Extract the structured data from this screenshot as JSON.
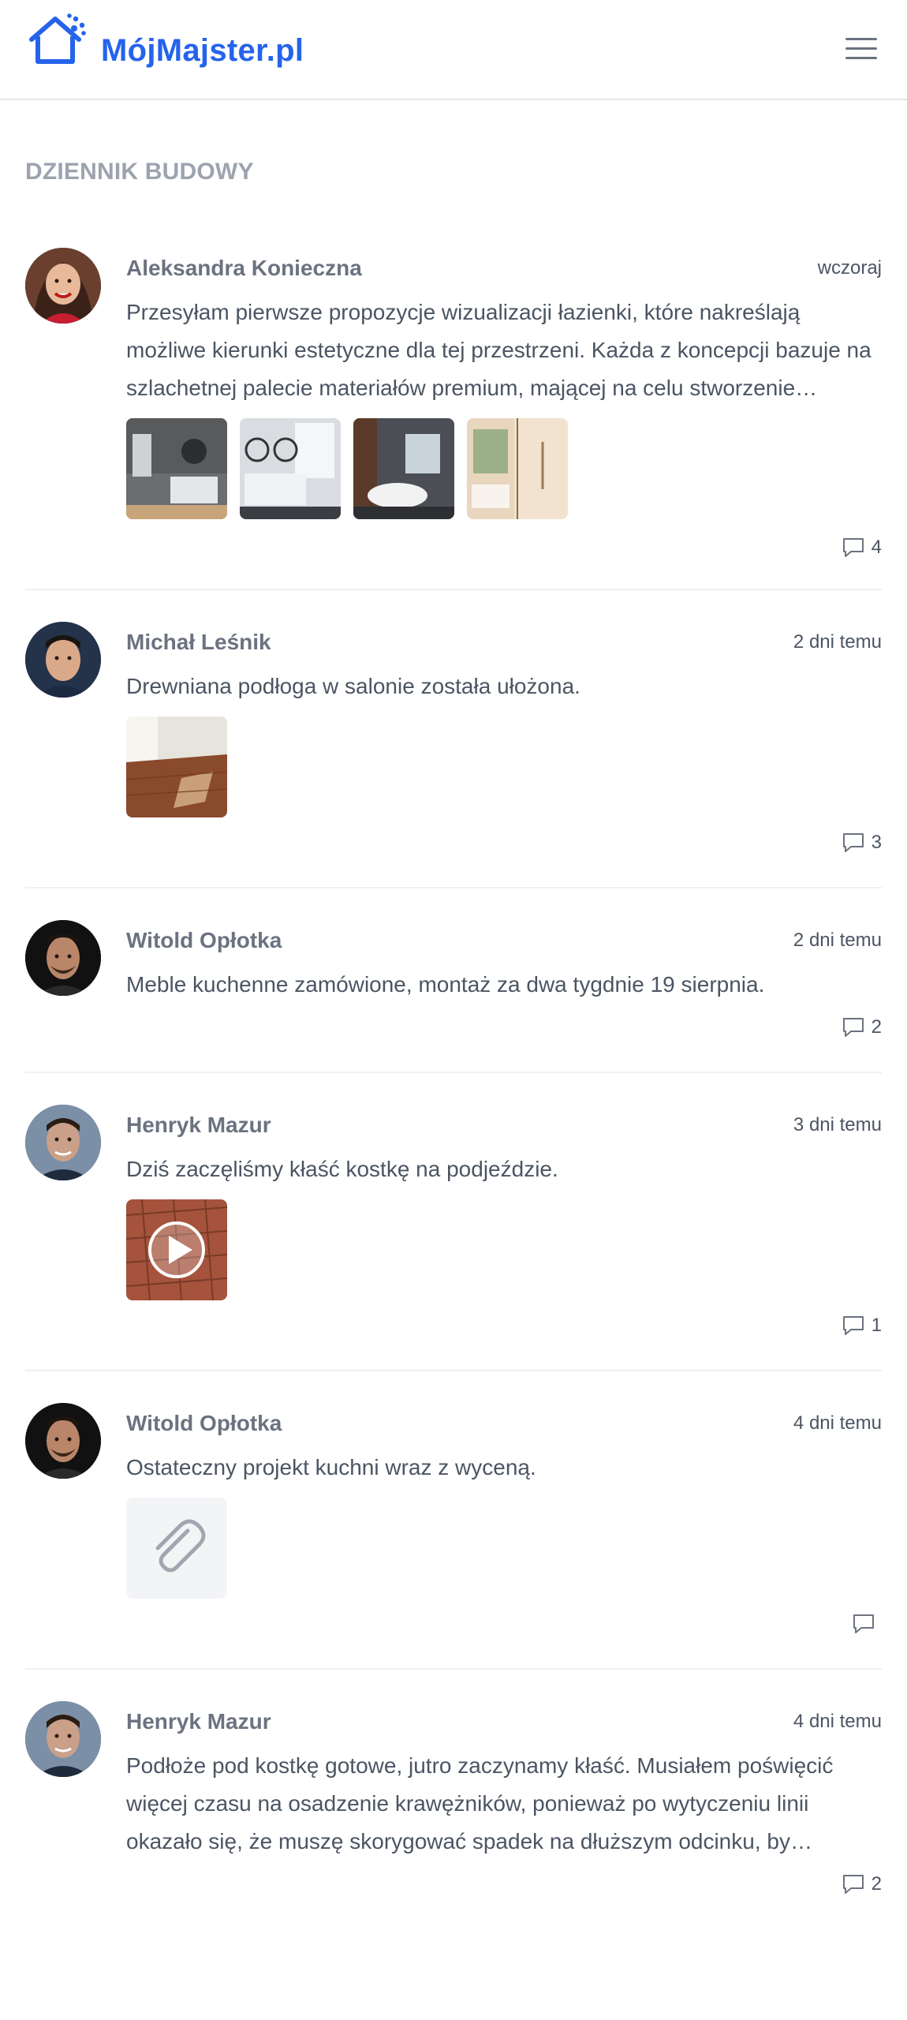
{
  "header": {
    "logo_text": "MójMajster.pl",
    "logo_icon": "house-icon",
    "menu_icon": "hamburger-menu-icon",
    "accent_color": "#2563eb"
  },
  "section_title": "DZIENNIK BUDOWY",
  "posts": [
    {
      "author": "Aleksandra Konieczna",
      "time": "wczoraj",
      "text": "Przesyłam pierwsze propozycje wizualizacji łazienki, które nakreślają możliwe kierunki estetyczne dla tej przestrzeni. Każda z koncepcji bazuje na szlachetnej palecie materiałów premium, mającej na celu stworzenie…",
      "attachments": [
        "bathroom-photo-1",
        "bathroom-photo-2",
        "bathroom-photo-3",
        "bathroom-photo-4"
      ],
      "comments": "4"
    },
    {
      "author": "Michał Leśnik",
      "time": "2 dni temu",
      "text": "Drewniana podłoga w salonie została ułożona.",
      "attachments": [
        "wooden-floor-photo"
      ],
      "comments": "3"
    },
    {
      "author": "Witold Opłotka",
      "time": "2 dni temu",
      "text": "Meble kuchenne zamówione, montaż za dwa tygdnie 19 sierpnia.",
      "attachments": [],
      "comments": "2"
    },
    {
      "author": "Henryk Mazur",
      "time": "3 dni temu",
      "text": "Dziś zaczęliśmy kłaść kostkę na podjeździe.",
      "attachments": [
        "paving-video"
      ],
      "comments": "1"
    },
    {
      "author": "Witold Opłotka",
      "time": "4 dni temu",
      "text": "Ostateczny projekt kuchni wraz z wyceną.",
      "attachments": [
        "file-attachment"
      ],
      "comments": ""
    },
    {
      "author": "Henryk Mazur",
      "time": "4 dni temu",
      "text": "Podłoże pod kostkę gotowe, jutro zaczynamy kłaść. Musiałem poświęcić więcej czasu na osadzenie krawężników, ponieważ po wytyczeniu linii okazało się, że muszę skorygować spadek na dłuższym odcinku, by…",
      "attachments": [],
      "comments": "2"
    }
  ]
}
